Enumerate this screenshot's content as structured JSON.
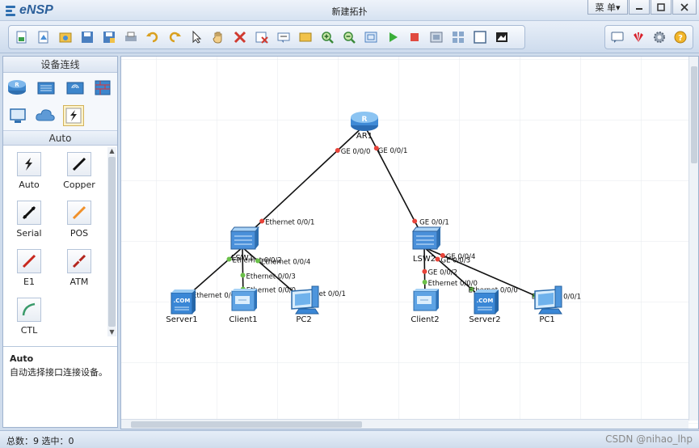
{
  "window": {
    "app_name": "eNSP",
    "title": "新建拓扑",
    "menu_label": "菜 单▾",
    "controls": [
      "minimize",
      "maximize",
      "close"
    ]
  },
  "toolbar": {
    "main_icons": [
      "new-topology-icon",
      "new-example-icon",
      "open-icon",
      "save-icon",
      "save-as-icon",
      "print-icon",
      "undo-icon",
      "redo-icon",
      "pointer-icon",
      "hand-icon",
      "delete-icon",
      "delete-links-icon",
      "text-icon",
      "palette-icon",
      "zoom-in-icon",
      "zoom-out-icon",
      "fit-icon",
      "start-icon",
      "stop-icon",
      "capture-icon",
      "grid-icon",
      "display-icon",
      "screenshot-icon"
    ],
    "right_icons": [
      "chat-icon",
      "huawei-icon",
      "settings-icon",
      "help-icon"
    ]
  },
  "left_panel": {
    "title": "设备连线",
    "categories": [
      "router",
      "switch",
      "wireless",
      "firewall",
      "pc",
      "cloud",
      "connection"
    ],
    "selected_category": "connection",
    "sub_title": "Auto",
    "cables": [
      {
        "label": "Auto",
        "icon": "auto-cable-icon"
      },
      {
        "label": "Copper",
        "icon": "copper-cable-icon"
      },
      {
        "label": "Serial",
        "icon": "serial-cable-icon"
      },
      {
        "label": "POS",
        "icon": "pos-cable-icon"
      },
      {
        "label": "E1",
        "icon": "e1-cable-icon"
      },
      {
        "label": "ATM",
        "icon": "atm-cable-icon"
      },
      {
        "label": "CTL",
        "icon": "ctl-cable-icon"
      }
    ],
    "description": {
      "title": "Auto",
      "text": "自动选择接口连接设备。"
    }
  },
  "topology": {
    "devices": [
      {
        "id": "AR1",
        "label": "AR1",
        "type": "router"
      },
      {
        "id": "LSW1",
        "label": "LSW1",
        "type": "switch"
      },
      {
        "id": "LSW2",
        "label": "LSW2",
        "type": "switch"
      },
      {
        "id": "Server1",
        "label": "Server1",
        "type": "server"
      },
      {
        "id": "Client1",
        "label": "Client1",
        "type": "client"
      },
      {
        "id": "PC2",
        "label": "PC2",
        "type": "pc"
      },
      {
        "id": "Client2",
        "label": "Client2",
        "type": "client"
      },
      {
        "id": "Server2",
        "label": "Server2",
        "type": "server"
      },
      {
        "id": "PC1",
        "label": "PC1",
        "type": "pc"
      }
    ],
    "links": [
      {
        "a": "AR1",
        "b": "LSW1",
        "a_port": "GE 0/0/0",
        "b_port": "Ethernet 0/0/1"
      },
      {
        "a": "AR1",
        "b": "LSW2",
        "a_port": "GE 0/0/1",
        "b_port": "GE 0/0/1"
      },
      {
        "a": "LSW1",
        "b": "Server1",
        "a_port": "Ethernet 0/0/2",
        "b_port": "Ethernet 0/0/0"
      },
      {
        "a": "LSW1",
        "b": "Client1",
        "a_port": "Ethernet 0/0/3",
        "b_port": "Ethernet 0/0/0"
      },
      {
        "a": "LSW1",
        "b": "PC2",
        "a_port": "Ethernet 0/0/4",
        "b_port": "Ethernet 0/0/1"
      },
      {
        "a": "LSW2",
        "b": "Client2",
        "a_port": "GE 0/0/2",
        "b_port": "Ethernet 0/0/0"
      },
      {
        "a": "LSW2",
        "b": "Server2",
        "a_port": "GE 0/0/3",
        "b_port": "Ethernet 0/0/0"
      },
      {
        "a": "LSW2",
        "b": "PC1",
        "a_port": "GE 0/0/4",
        "b_port": "Ethernet 0/0/1"
      }
    ]
  },
  "status": {
    "text": "总数：9  选中：0"
  },
  "watermark": "CSDN @nihao_lhp"
}
